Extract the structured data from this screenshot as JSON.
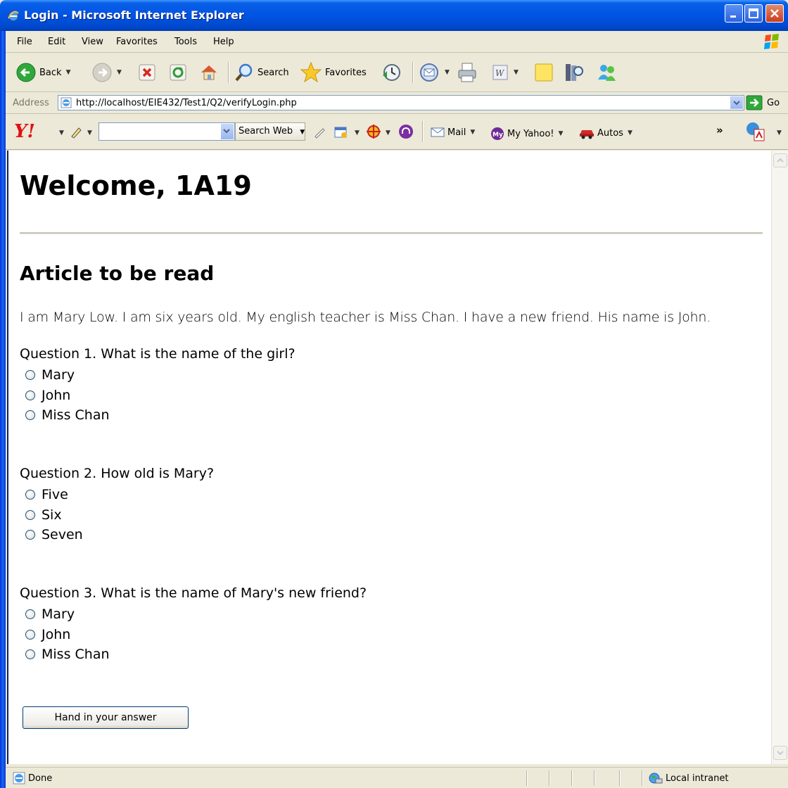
{
  "window": {
    "title": "Login - Microsoft Internet Explorer"
  },
  "menu": {
    "items": [
      "File",
      "Edit",
      "View",
      "Favorites",
      "Tools",
      "Help"
    ]
  },
  "toolbar": {
    "back_label": "Back",
    "search_label": "Search",
    "favorites_label": "Favorites"
  },
  "address": {
    "label": "Address",
    "url": "http://localhost/EIE432/Test1/Q2/verifyLogin.php",
    "go_label": "Go"
  },
  "yahoo": {
    "search_button": "Search Web",
    "mail_label": "Mail",
    "my_yahoo_label": "My Yahoo!",
    "autos_label": "Autos",
    "more_label": "»"
  },
  "page": {
    "welcome": "Welcome, 1A19",
    "article_heading": "Article to be read",
    "article_text": "I am Mary Low. I am six years old. My english teacher is Miss Chan. I have a new friend. His name is John.",
    "questions": [
      {
        "text": "Question 1. What is the name of the girl?",
        "options": [
          "Mary",
          "John",
          "Miss Chan"
        ]
      },
      {
        "text": "Question 2. How old is Mary?",
        "options": [
          "Five",
          "Six",
          "Seven"
        ]
      },
      {
        "text": "Question 3. What is the name of Mary's new friend?",
        "options": [
          "Mary",
          "John",
          "Miss Chan"
        ]
      }
    ],
    "submit_label": "Hand in your answer"
  },
  "status": {
    "text": "Done",
    "zone": "Local intranet"
  }
}
